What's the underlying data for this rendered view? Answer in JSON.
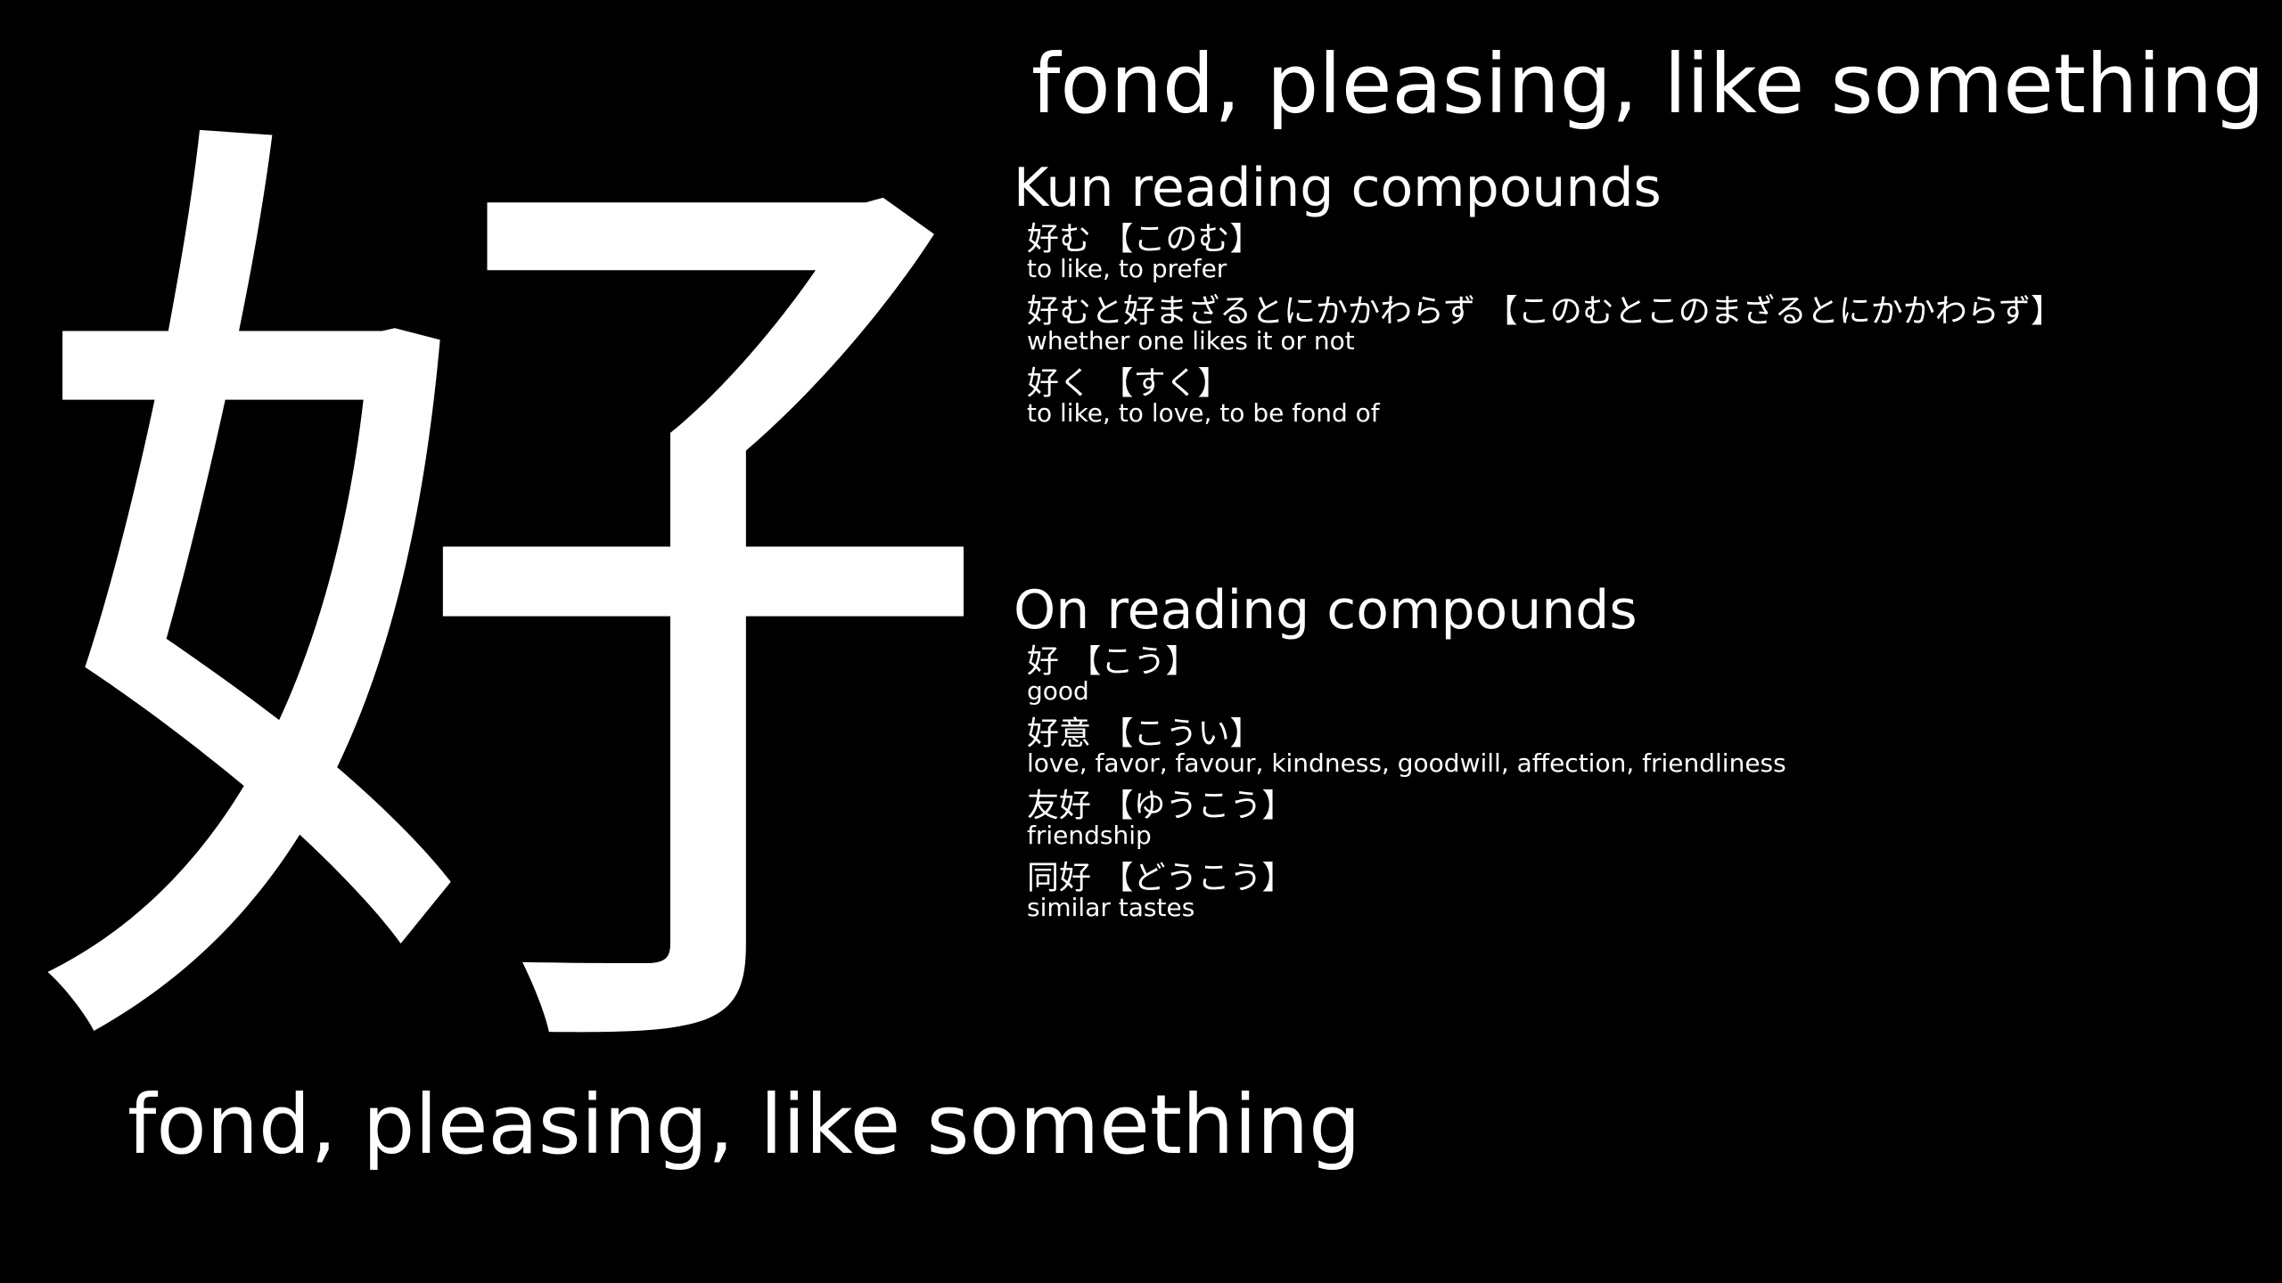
{
  "kanji": "好",
  "meaning": "fond, pleasing, like something",
  "kun_heading": "Kun reading compounds",
  "kun_compounds": [
    {
      "word": "好む 【このむ】",
      "gloss": "to like, to prefer"
    },
    {
      "word": "好むと好まざるとにかかわらず 【このむとこのまざるとにかかわらず】",
      "gloss": "whether one likes it or not"
    },
    {
      "word": "好く 【すく】",
      "gloss": "to like, to love, to be fond of"
    }
  ],
  "on_heading": "On reading compounds",
  "on_compounds": [
    {
      "word": "好 【こう】",
      "gloss": "good"
    },
    {
      "word": "好意 【こうい】",
      "gloss": "love, favor, favour, kindness, goodwill, affection, friendliness"
    },
    {
      "word": "友好 【ゆうこう】",
      "gloss": "friendship"
    },
    {
      "word": "同好 【どうこう】",
      "gloss": "similar tastes"
    }
  ],
  "colors": {
    "background": "#000000",
    "text": "#ffffff"
  }
}
